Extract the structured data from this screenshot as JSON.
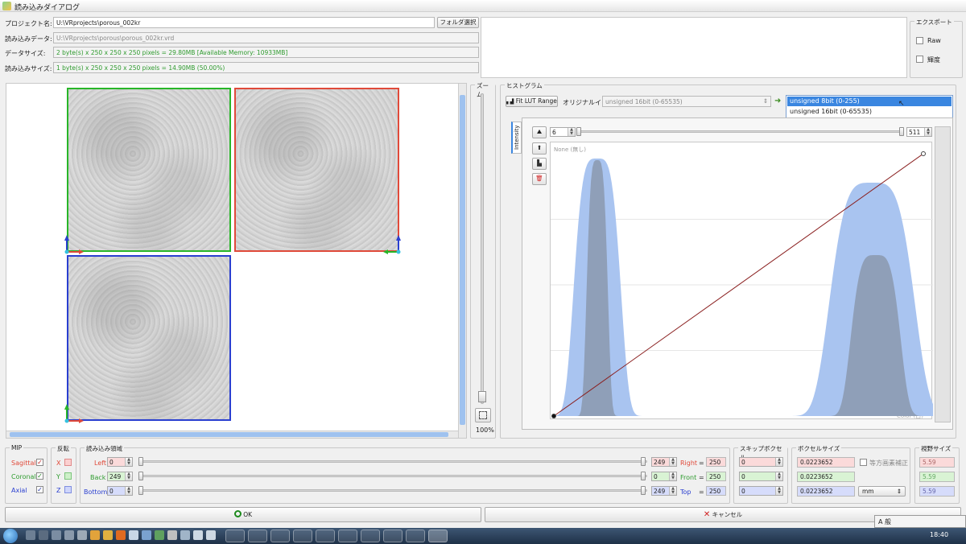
{
  "window": {
    "title": "読み込みダイアログ"
  },
  "info": {
    "project_label": "プロジェクト名:",
    "project_value": "U:\\VRprojects\\porous_002kr",
    "folder_button": "フォルダ選択",
    "data_label": "読み込みデータ:",
    "data_value": "U:\\VRprojects\\porous\\porous_002kr.vrd",
    "datasize_label": "データサイズ:",
    "datasize_value": "2 byte(s) x 250 x 250 x 250 pixels = 29.80MB  [Available Memory: 10933MB]",
    "loadsize_label": "読み込みサイズ:",
    "loadsize_value": "1 byte(s) x 250 x 250 x 250 pixels = 14.90MB (50.00%)"
  },
  "export": {
    "legend": "エクスポート",
    "raw": "Raw",
    "luminance": "輝度"
  },
  "zoom": {
    "legend": "ズーム",
    "percent": "100%"
  },
  "histogram": {
    "legend": "ヒストグラム",
    "fit_button": "Fit LUT Range",
    "original_label": "オリジナルイン",
    "original_select": "unsigned 16bit (0-65535)",
    "output_options": [
      "unsigned 8bit (0-255)",
      "unsigned 16bit (0-65535)"
    ],
    "tab_label": "Intensity",
    "min_value": "6",
    "max_value": "511",
    "none_label": "None (無し)",
    "color_label": "Color (白)"
  },
  "colors": {
    "sagittal": "#28b628",
    "coronal": "#e04a3a",
    "axial": "#2a3fd0",
    "hist_fill": "#a9c4f0",
    "hist_dark": "#8f9fb8",
    "lut_line": "#8a1f1f"
  },
  "mip": {
    "legend": "MIP",
    "sagittal": "Sagittal",
    "coronal": "Coronal",
    "axial": "Axial"
  },
  "flip": {
    "legend": "反転",
    "x": "X",
    "y": "Y",
    "z": "Z"
  },
  "region": {
    "legend": "読み込み領域",
    "left_label": "Left",
    "left_value": "0",
    "right_value": "249",
    "right_label": "Right",
    "eq": "=",
    "right_total": "250",
    "back_label": "Back",
    "back_value": "249",
    "front_value": "0",
    "front_label": "Front",
    "front_total": "250",
    "bottom_label": "Bottom",
    "bottom_value": "0",
    "top_value": "249",
    "top_label": "Top",
    "top_total": "250"
  },
  "skip": {
    "legend": "スキップボクセル",
    "x": "0",
    "y": "0",
    "z": "0"
  },
  "voxel": {
    "legend": "ボクセルサイズ",
    "x": "0.0223652",
    "y": "0.0223652",
    "z": "0.0223652",
    "iso_label": "等方画素補正",
    "unit": "mm"
  },
  "fov": {
    "legend": "視野サイズ",
    "x": "5.59",
    "y": "5.59",
    "z": "5.59"
  },
  "buttons": {
    "ok": "OK",
    "cancel": "キャンセル"
  },
  "taskbar": {
    "clock": "18:40",
    "ime": "A 般"
  },
  "histogram_data": {
    "type": "area",
    "x_range": [
      0,
      511
    ],
    "peaks": [
      {
        "center": 60,
        "width": 40
      },
      {
        "center": 440,
        "width": 60
      }
    ]
  }
}
